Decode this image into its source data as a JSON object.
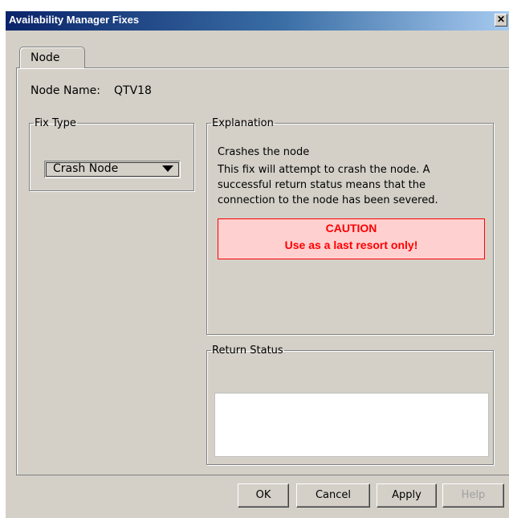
{
  "window": {
    "title": "Availability Manager Fixes",
    "close_glyph": "✕"
  },
  "tabs": [
    {
      "label": "Node"
    }
  ],
  "node": {
    "label": "Node Name:",
    "value": "QTV18"
  },
  "fix_type": {
    "legend": "Fix Type",
    "selected": "Crash Node"
  },
  "explanation": {
    "legend": "Explanation",
    "title": "Crashes the node",
    "body": "This fix will attempt to crash the node. A successful return status means that the connection to the node has been severed.",
    "caution_title": "CAUTION",
    "caution_body": "Use as a last resort only!"
  },
  "return_status": {
    "legend": "Return Status",
    "value": ""
  },
  "buttons": {
    "ok": "OK",
    "cancel": "Cancel",
    "apply": "Apply",
    "help": "Help"
  },
  "colors": {
    "caution_text": "#ff0000",
    "caution_bg": "#ffd0d0",
    "title_bar": "#0a246a"
  }
}
